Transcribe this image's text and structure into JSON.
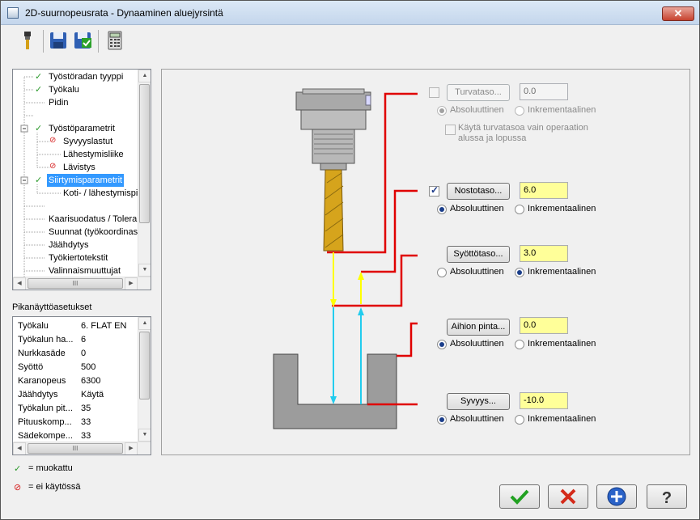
{
  "window": {
    "title": "2D-suurnopeusrata - Dynaaminen aluejyrsintä"
  },
  "toolbar": {
    "icons": [
      "tool-icon",
      "save-icon",
      "save-as-icon",
      "calculator-icon"
    ]
  },
  "tree": {
    "items": [
      {
        "label": "Työstöradan tyyppi",
        "status": "muokattu"
      },
      {
        "label": "Työkalu",
        "status": "muokattu"
      },
      {
        "label": "Pidin",
        "status": ""
      },
      {
        "label": "Työstöparametrit",
        "status": "muokattu"
      },
      {
        "label": "Syvyyslastut",
        "status": "ei käytössä"
      },
      {
        "label": "Lähestymisliike",
        "status": ""
      },
      {
        "label": "Lävistys",
        "status": "ei käytössä"
      },
      {
        "label": "Siirtymisparametrit",
        "status": "muokattu",
        "selected": true
      },
      {
        "label": "Koti- / lähestymispi",
        "status": ""
      },
      {
        "label": "Kaarisuodatus / Tolera",
        "status": ""
      },
      {
        "label": "Suunnat (työkoordinast",
        "status": ""
      },
      {
        "label": "Jäähdytys",
        "status": ""
      },
      {
        "label": "Työkiertotekstit",
        "status": ""
      },
      {
        "label": "Valinnaismuuttujat",
        "status": ""
      }
    ],
    "hscroll_label": "III"
  },
  "quick": {
    "title": "Pikanäyttöasetukset",
    "rows": [
      {
        "k": "Työkalu",
        "v": "6. FLAT EN"
      },
      {
        "k": "Työkalun ha...",
        "v": "6"
      },
      {
        "k": "Nurkkasäde",
        "v": "0"
      },
      {
        "k": "Syöttö",
        "v": "500"
      },
      {
        "k": "Karanopeus",
        "v": "6300"
      },
      {
        "k": "Jäähdytys",
        "v": "Käytä"
      },
      {
        "k": "Työkalun pit...",
        "v": "35"
      },
      {
        "k": "Pituuskomp...",
        "v": "33"
      },
      {
        "k": "Sädekompe...",
        "v": "33"
      }
    ]
  },
  "legend": {
    "modified": "= muokattu",
    "disabled": "= ei käytössä"
  },
  "params": {
    "clearance": {
      "enabled": false,
      "label": "Turvataso...",
      "value": "0.0",
      "abs": "Absoluuttinen",
      "inc": "Inkrementaalinen",
      "selected": "abs",
      "only_label": "Käytä turvatasoa vain operaation alussa ja lopussa"
    },
    "retract": {
      "enabled": true,
      "label": "Nostotaso...",
      "value": "6.0",
      "abs": "Absoluuttinen",
      "inc": "Inkrementaalinen",
      "selected": "abs"
    },
    "feed": {
      "label": "Syöttötaso...",
      "value": "3.0",
      "abs": "Absoluuttinen",
      "inc": "Inkrementaalinen",
      "selected": "inc"
    },
    "top": {
      "label": "Aihion pinta...",
      "value": "0.0",
      "abs": "Absoluuttinen",
      "inc": "Inkrementaalinen",
      "selected": "abs"
    },
    "depth": {
      "label": "Syvyys...",
      "value": "-10.0",
      "abs": "Absoluuttinen",
      "inc": "Inkrementaalinen",
      "selected": "abs"
    }
  },
  "colors": {
    "red_line": "#e00000",
    "yellow_arrow": "#ffff00",
    "cyan_arrow": "#22ccee",
    "highlight_field": "#ffff99",
    "selection": "#3399ff"
  },
  "buttons": {
    "ok": "check-icon",
    "cancel": "x-icon",
    "add": "plus-icon",
    "help": "help-icon"
  }
}
